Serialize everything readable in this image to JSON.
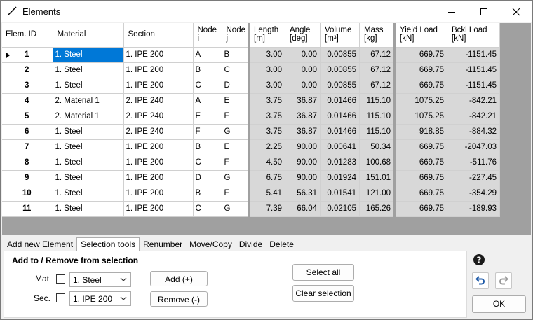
{
  "window": {
    "title": "Elements"
  },
  "grid": {
    "headers": [
      {
        "l1": "Elem. ID",
        "l2": ""
      },
      {
        "l1": "Material",
        "l2": ""
      },
      {
        "l1": "Section",
        "l2": ""
      },
      {
        "l1": "Node",
        "l2": "i"
      },
      {
        "l1": "Node",
        "l2": "j"
      },
      {
        "l1": "Length",
        "l2": "[m]"
      },
      {
        "l1": "Angle",
        "l2": "[deg]"
      },
      {
        "l1": "Volume",
        "l2": "[m³]"
      },
      {
        "l1": "Mass",
        "l2": "[kg]"
      },
      {
        "l1": "Yield Load",
        "l2": "[kN]"
      },
      {
        "l1": "Bckl Load",
        "l2": "[kN]"
      }
    ],
    "rows": [
      {
        "id": "1",
        "material": "1. Steel",
        "section": "1. IPE 200",
        "ni": "A",
        "nj": "B",
        "length": "3.00",
        "angle": "0.00",
        "volume": "0.00855",
        "mass": "67.12",
        "yield": "669.75",
        "bckl": "-1151.45"
      },
      {
        "id": "2",
        "material": "1. Steel",
        "section": "1. IPE 200",
        "ni": "B",
        "nj": "C",
        "length": "3.00",
        "angle": "0.00",
        "volume": "0.00855",
        "mass": "67.12",
        "yield": "669.75",
        "bckl": "-1151.45"
      },
      {
        "id": "3",
        "material": "1. Steel",
        "section": "1. IPE 200",
        "ni": "C",
        "nj": "D",
        "length": "3.00",
        "angle": "0.00",
        "volume": "0.00855",
        "mass": "67.12",
        "yield": "669.75",
        "bckl": "-1151.45"
      },
      {
        "id": "4",
        "material": "2. Material 1",
        "section": "2. IPE 240",
        "ni": "A",
        "nj": "E",
        "length": "3.75",
        "angle": "36.87",
        "volume": "0.01466",
        "mass": "115.10",
        "yield": "1075.25",
        "bckl": "-842.21"
      },
      {
        "id": "5",
        "material": "2. Material 1",
        "section": "2. IPE 240",
        "ni": "E",
        "nj": "F",
        "length": "3.75",
        "angle": "36.87",
        "volume": "0.01466",
        "mass": "115.10",
        "yield": "1075.25",
        "bckl": "-842.21"
      },
      {
        "id": "6",
        "material": "1. Steel",
        "section": "2. IPE 240",
        "ni": "F",
        "nj": "G",
        "length": "3.75",
        "angle": "36.87",
        "volume": "0.01466",
        "mass": "115.10",
        "yield": "918.85",
        "bckl": "-884.32"
      },
      {
        "id": "7",
        "material": "1. Steel",
        "section": "1. IPE 200",
        "ni": "B",
        "nj": "E",
        "length": "2.25",
        "angle": "90.00",
        "volume": "0.00641",
        "mass": "50.34",
        "yield": "669.75",
        "bckl": "-2047.03"
      },
      {
        "id": "8",
        "material": "1. Steel",
        "section": "1. IPE 200",
        "ni": "C",
        "nj": "F",
        "length": "4.50",
        "angle": "90.00",
        "volume": "0.01283",
        "mass": "100.68",
        "yield": "669.75",
        "bckl": "-511.76"
      },
      {
        "id": "9",
        "material": "1. Steel",
        "section": "1. IPE 200",
        "ni": "D",
        "nj": "G",
        "length": "6.75",
        "angle": "90.00",
        "volume": "0.01924",
        "mass": "151.01",
        "yield": "669.75",
        "bckl": "-227.45"
      },
      {
        "id": "10",
        "material": "1. Steel",
        "section": "1. IPE 200",
        "ni": "B",
        "nj": "F",
        "length": "5.41",
        "angle": "56.31",
        "volume": "0.01541",
        "mass": "121.00",
        "yield": "669.75",
        "bckl": "-354.29"
      },
      {
        "id": "11",
        "material": "1. Steel",
        "section": "1. IPE 200",
        "ni": "C",
        "nj": "G",
        "length": "7.39",
        "angle": "66.04",
        "volume": "0.02105",
        "mass": "165.26",
        "yield": "669.75",
        "bckl": "-189.93"
      }
    ]
  },
  "tabs": [
    "Add new Element",
    "Selection tools",
    "Renumber",
    "Move/Copy",
    "Divide",
    "Delete"
  ],
  "active_tab": "Selection tools",
  "panel": {
    "title": "Add to / Remove from selection",
    "mat_label": "Mat",
    "mat_value": "1. Steel",
    "sec_label": "Sec.",
    "sec_value": "1. IPE 200",
    "add_button": "Add (+)",
    "remove_button": "Remove (-)",
    "select_all_button": "Select all",
    "clear_selection_button": "Clear selection"
  },
  "ok_button": "OK",
  "colors": {
    "selection": "#0078d7",
    "grid_background": "#a0a0a0",
    "readonly_cell": "#d8d8d8"
  }
}
